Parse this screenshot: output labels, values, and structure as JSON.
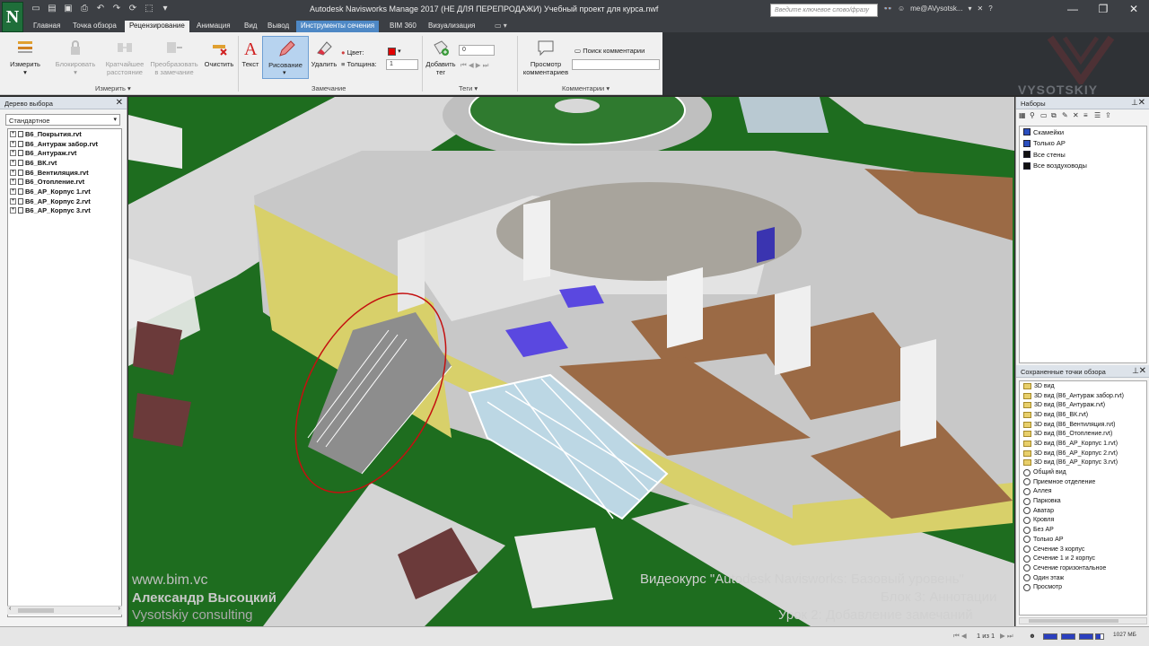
{
  "window": {
    "title": "Autodesk Navisworks Manage 2017 (НЕ ДЛЯ ПЕРЕПРОДАЖИ)     Учебный проект для курса.nwf",
    "app_logo": "N",
    "search_placeholder": "Введите ключевое слово/фразу",
    "user": "me@AVysotsk...",
    "controls": [
      "—",
      "❐",
      "✕"
    ]
  },
  "tabs": [
    {
      "label": "Главная"
    },
    {
      "label": "Точка обзора"
    },
    {
      "label": "Рецензирование",
      "active": true
    },
    {
      "label": "Анимация"
    },
    {
      "label": "Вид"
    },
    {
      "label": "Вывод"
    },
    {
      "label": "Инструменты сечения",
      "context": true
    },
    {
      "label": "BIM 360"
    },
    {
      "label": "Визуализация"
    }
  ],
  "ribbon": {
    "measure": {
      "label": "Измерить",
      "icon": "ruler-icon"
    },
    "lock": {
      "label": "Блокировать"
    },
    "shortest": {
      "label": "Кратчайшее расстояние"
    },
    "convert": {
      "label": "Преобразовать в замечание"
    },
    "clear": {
      "label": "Очистить"
    },
    "measure_panel": "Измерить ▾",
    "text": {
      "label": "Текст"
    },
    "draw": {
      "label": "Рисование"
    },
    "erase": {
      "label": "Удалить"
    },
    "color_label": "Цвет:",
    "thickness_label": "Толщина:",
    "thickness_value": "1",
    "markup_panel": "Замечание",
    "add_tag": {
      "label": "Добавить тег"
    },
    "tag_value": "0",
    "tags_panel": "Теги ▾",
    "view_comments": {
      "label": "Просмотр комментариев"
    },
    "find_comments": "Поиск комментарии",
    "comments_panel": "Комментарии ▾",
    "accent_color": "#e10000"
  },
  "left_panel": {
    "title": "Дерево выбора",
    "select_value": "Стандартное",
    "items": [
      "В6_Покрытия.rvt",
      "В6_Антураж забор.rvt",
      "В6_Антураж.rvt",
      "В6_ВК.rvt",
      "В6_Вентиляция.rvt",
      "В6_Отопление.rvt",
      "В6_АР_Корпус 1.rvt",
      "В6_АР_Корпус 2.rvt",
      "В6_АР_Корпус 3.rvt"
    ]
  },
  "sets_panel": {
    "title": "Наборы",
    "items": [
      {
        "label": "Скамейки",
        "icon": "set-icon"
      },
      {
        "label": "Только АР",
        "icon": "set-icon"
      },
      {
        "label": "Все стены",
        "icon": "search-set-icon"
      },
      {
        "label": "Все воздуховоды",
        "icon": "search-set-icon"
      }
    ]
  },
  "viewpoints_panel": {
    "title": "Сохраненные точки обзора",
    "folders": [
      "3D вид",
      "3D вид (В6_Антураж забор.rvt)",
      "3D вид (В6_Антураж.rvt)",
      "3D вид (В6_ВК.rvt)",
      "3D вид (В6_Вентиляция.rvt)",
      "3D вид (В6_Отопление.rvt)",
      "3D вид (В6_АР_Корпус 1.rvt)",
      "3D вид (В6_АР_Корпус 2.rvt)",
      "3D вид (В6_АР_Корпус 3.rvt)"
    ],
    "views": [
      "Общий вид",
      "Приемное отделение",
      "Аллея",
      "Парковка",
      "Аватар",
      "Кровля",
      "Без АР",
      "Только АР",
      "Сечение 3 корпус",
      "Сечение 1 и 2 корпус",
      "Сечение горизонтальное",
      "Один этаж",
      "Просмотр"
    ]
  },
  "watermarks": {
    "site": "www.bim.vc",
    "author": "Александр Высоцкий",
    "company": "Vysotskiy consulting",
    "course_line1": "Видеокурс \"Autodesk Navisworks: Базовый уровень\"",
    "course_line2": "Блок 3: Аннотации",
    "course_line3": "Урок 2: Добавление замечаний",
    "brand": "VYSOTSKIY"
  },
  "status": {
    "page": "1 из 1",
    "memory": "1027 МБ"
  }
}
